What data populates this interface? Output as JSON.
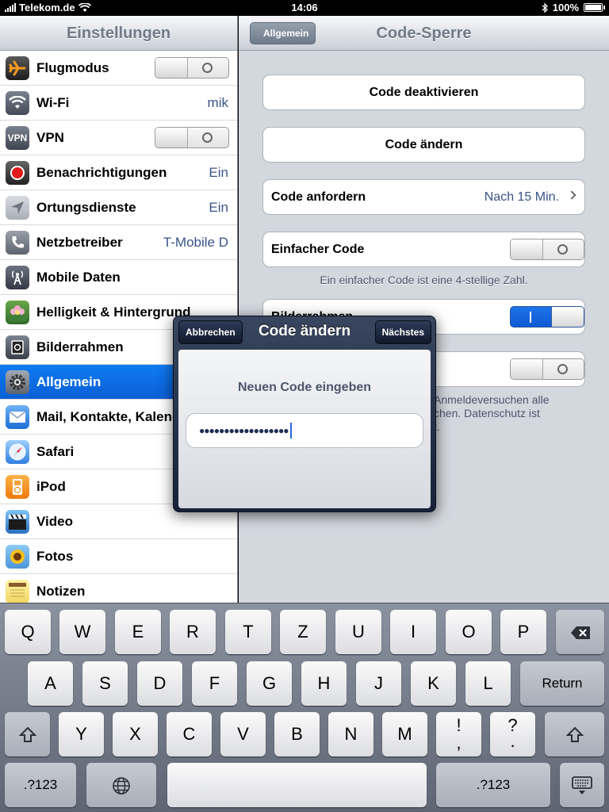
{
  "status": {
    "carrier": "Telekom.de",
    "time": "14:06",
    "battery": "100%"
  },
  "left": {
    "title": "Einstellungen",
    "items": [
      {
        "label": "Flugmodus",
        "icon": "airplane-icon",
        "switch": "off"
      },
      {
        "label": "Wi-Fi",
        "icon": "wifi-icon",
        "value": "mik"
      },
      {
        "label": "VPN",
        "icon": "vpn-icon",
        "icon_text": "VPN",
        "switch": "off"
      },
      {
        "label": "Benachrichtigungen",
        "icon": "notifications-icon",
        "value": "Ein"
      },
      {
        "label": "Ortungsdienste",
        "icon": "location-icon",
        "value": "Ein"
      },
      {
        "label": "Netzbetreiber",
        "icon": "phone-icon",
        "value": "T-Mobile D"
      },
      {
        "label": "Mobile Daten",
        "icon": "antenna-icon"
      },
      {
        "label": "Helligkeit & Hintergrund",
        "icon": "flower-icon"
      },
      {
        "label": "Bilderrahmen",
        "icon": "picture-frame-icon"
      },
      {
        "label": "Allgemein",
        "icon": "gear-icon",
        "selected": true
      },
      {
        "label": "Mail, Kontakte, Kalender",
        "icon": "mail-icon"
      },
      {
        "label": "Safari",
        "icon": "compass-icon"
      },
      {
        "label": "iPod",
        "icon": "ipod-icon"
      },
      {
        "label": "Video",
        "icon": "clapper-icon"
      },
      {
        "label": "Fotos",
        "icon": "sunflower-icon"
      },
      {
        "label": "Notizen",
        "icon": "notepad-icon"
      }
    ]
  },
  "right": {
    "back_label": "Allgemein",
    "title": "Code-Sperre",
    "code_off": "Code deaktivieren",
    "code_change": "Code ändern",
    "require_label": "Code anfordern",
    "require_value": "Nach 15 Min.",
    "simple_label": "Einfacher Code",
    "simple_switch": "off",
    "simple_note": "Ein einfacher Code ist eine 4-stellige Zahl.",
    "frame_label": "Bilderrahmen",
    "frame_switch": "on",
    "erase_switch": "off",
    "erase_note_line1": "Anmeldeversuchen alle",
    "erase_note_line2": "chen.  Datenschutz ist",
    "erase_note_line3": "t."
  },
  "alert": {
    "title": "Code ändern",
    "cancel": "Abbrechen",
    "next": "Nächstes",
    "prompt": "Neuen Code eingeben",
    "dots": "●●●●●●●●●●●●●●●●●●"
  },
  "keyboard": {
    "row1": [
      "Q",
      "W",
      "E",
      "R",
      "T",
      "Z",
      "U",
      "I",
      "O",
      "P"
    ],
    "row2": [
      "A",
      "S",
      "D",
      "F",
      "G",
      "H",
      "J",
      "K",
      "L"
    ],
    "row3": [
      "Y",
      "X",
      "C",
      "V",
      "B",
      "N",
      "M"
    ],
    "return": "Return",
    "numbers": ".?123",
    "punct1_top": "!",
    "punct1_bottom": ",",
    "punct2_top": "?",
    "punct2_bottom": "."
  }
}
